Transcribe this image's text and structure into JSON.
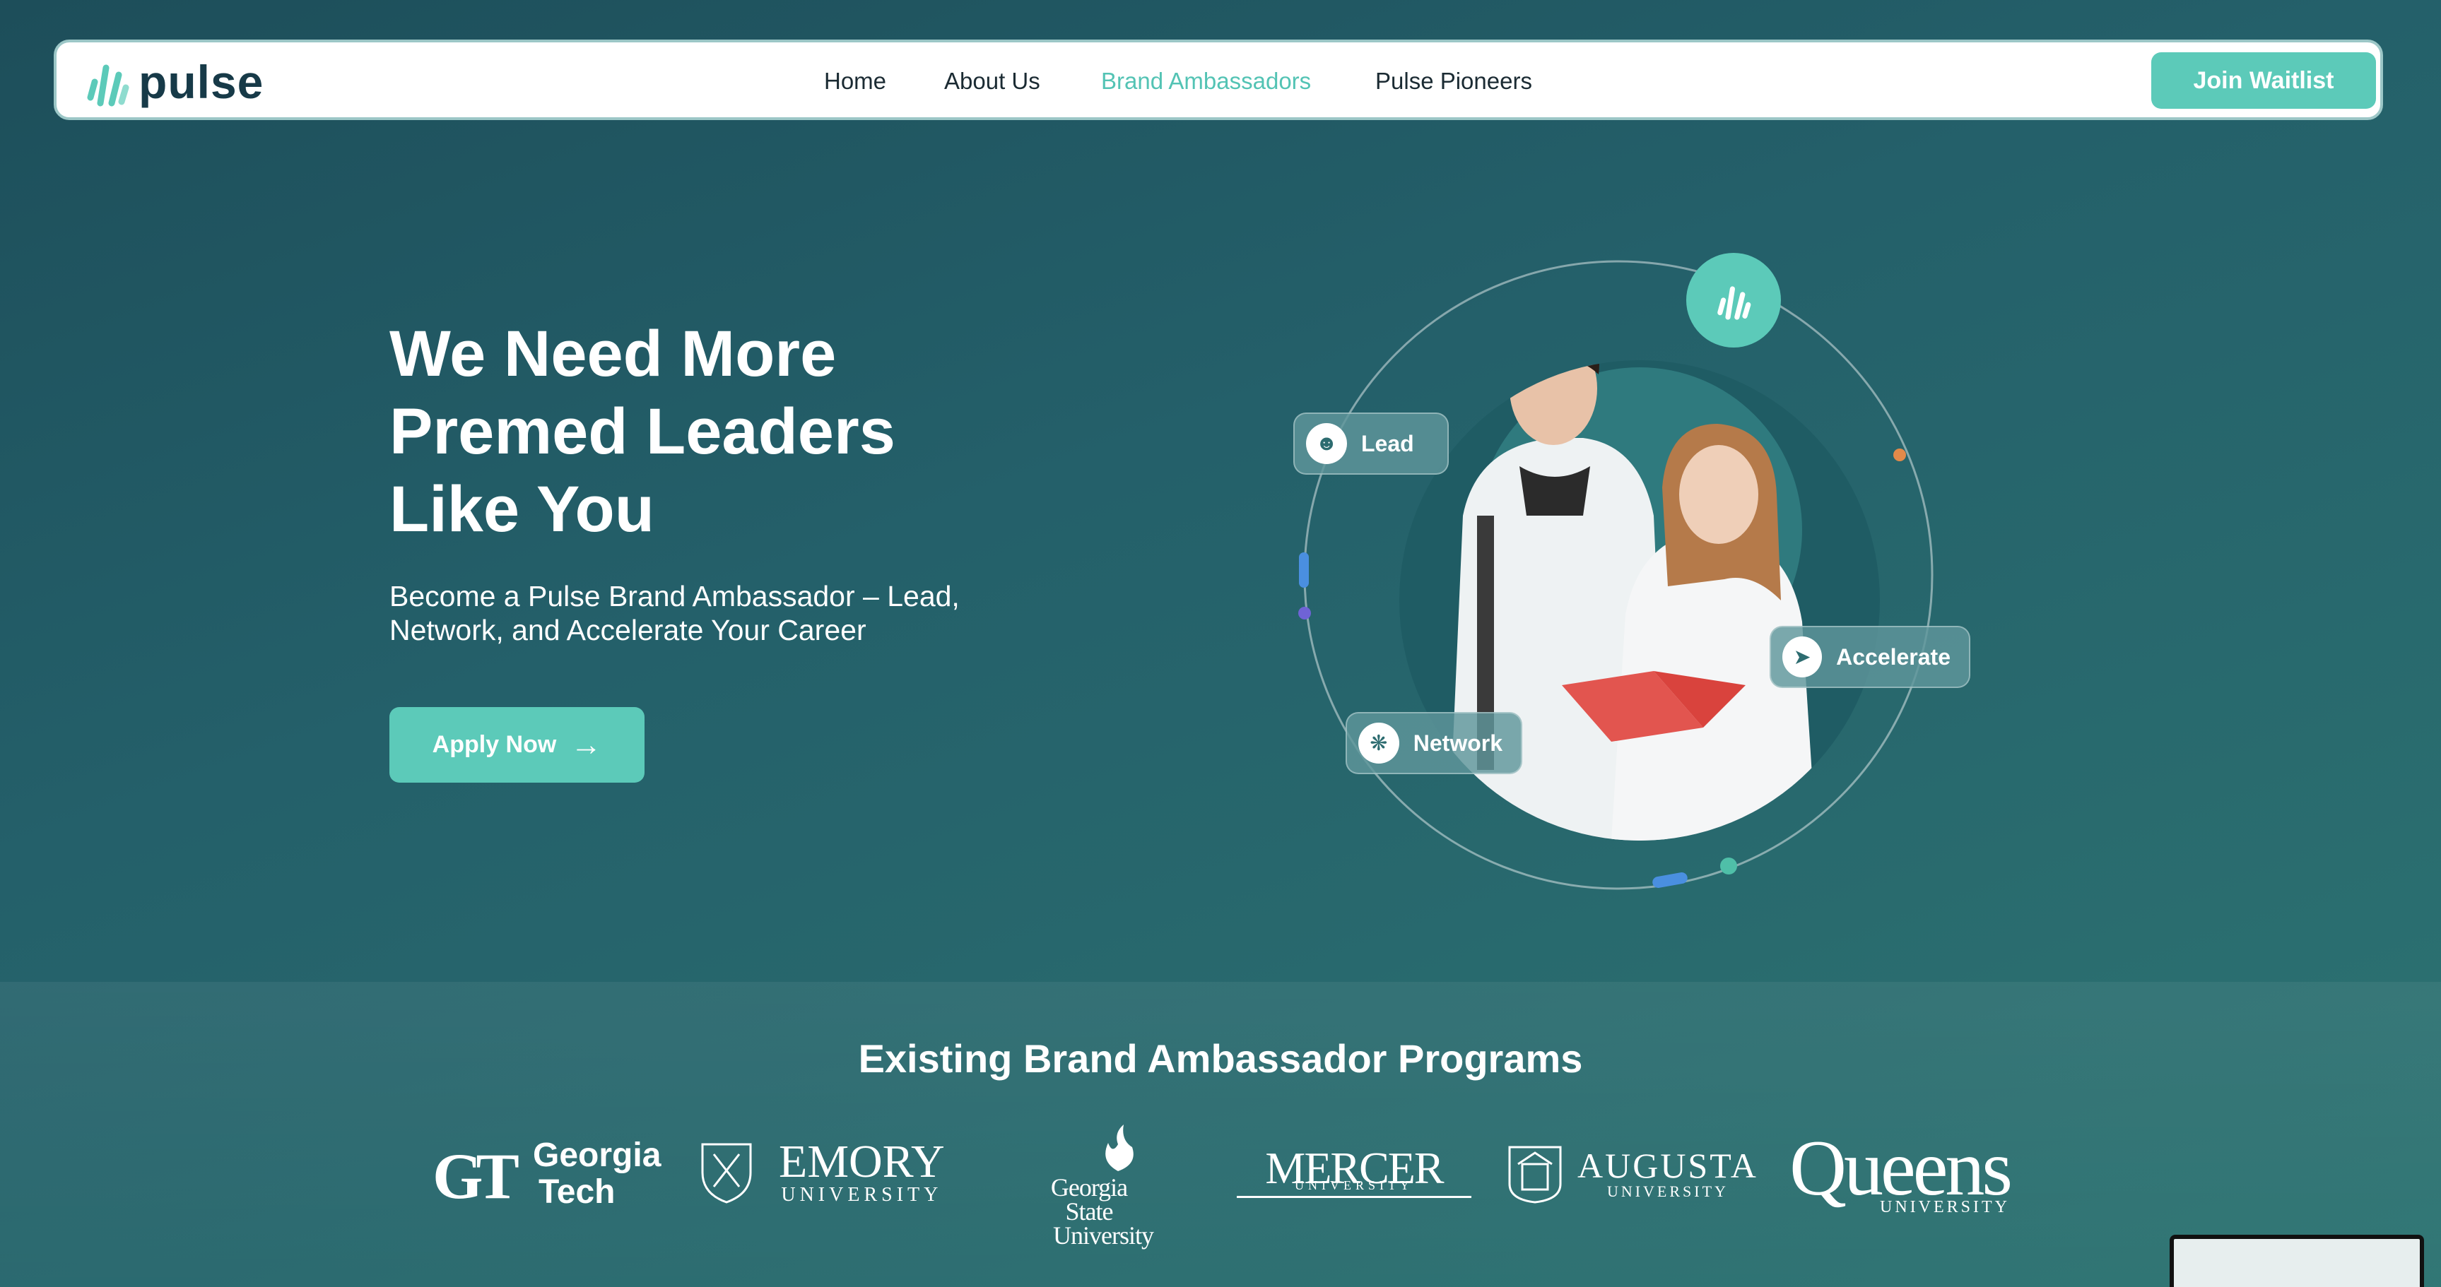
{
  "nav": {
    "logo_text": "pulse",
    "links": [
      "Home",
      "About Us",
      "Brand Ambassadors",
      "Pulse Pioneers"
    ],
    "active": "Brand Ambassadors",
    "cta": "Join Waitlist"
  },
  "hero": {
    "title_lines": [
      "We Need More",
      "Premed Leaders",
      "Like You"
    ],
    "subtitle_lines": [
      "Become a Pulse Brand Ambassador – Lead,",
      "Network, and Accelerate Your Career"
    ],
    "cta": "Apply Now"
  },
  "illustration": {
    "badges": [
      "Lead",
      "Network",
      "Accelerate"
    ]
  },
  "programs": {
    "title": "Existing Brand Ambassador Programs",
    "universities": {
      "gt": {
        "mark": "GT",
        "line1": "Georgia",
        "line2": "Tech"
      },
      "emory": {
        "line1": "EMORY",
        "line2": "UNIVERSITY"
      },
      "gsu": {
        "line1": "Georgia State",
        "line2": "University"
      },
      "mercer": {
        "line1": "MERCER",
        "line2": "UNIVERSITY"
      },
      "augusta": {
        "line1": "AUGUSTA",
        "line2": "UNIVERSITY"
      },
      "queens": {
        "line1": "Queens",
        "line2": "UNIVERSITY"
      }
    }
  },
  "colors": {
    "accent": "#5ccab9",
    "nav_bg": "#ffffff",
    "bg_dark": "#1d4e5a",
    "bg_light": "#2d7472"
  }
}
